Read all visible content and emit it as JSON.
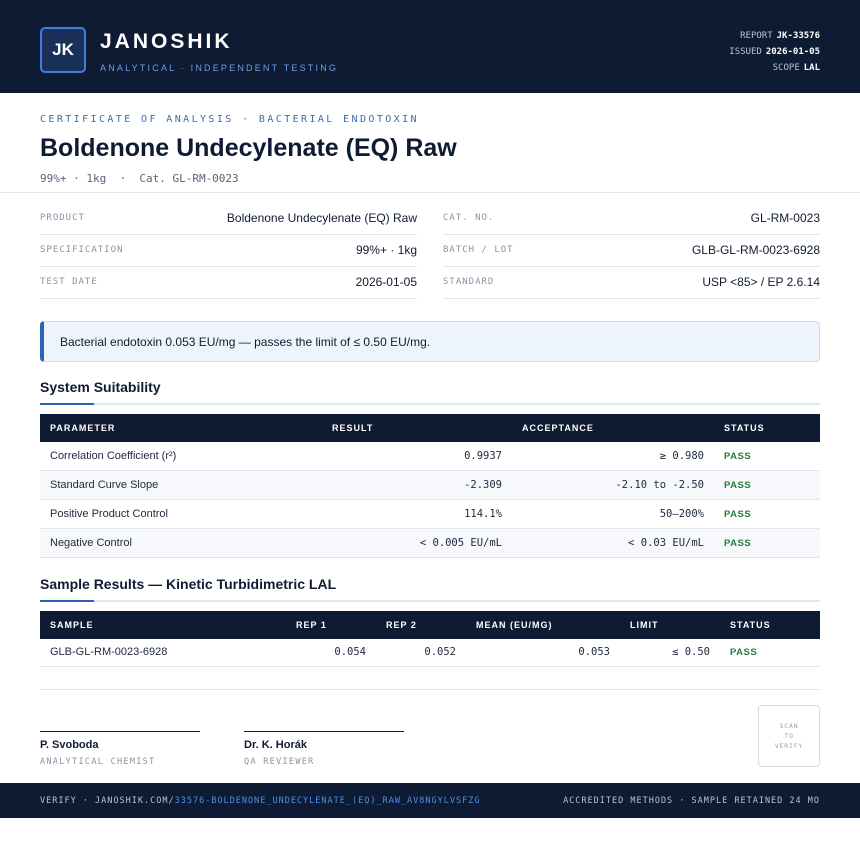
{
  "header": {
    "logo_text": "JK",
    "brand": "JANOSHIK",
    "brand_sub": "ANALYTICAL · INDEPENDENT TESTING",
    "report_label": "REPORT",
    "report_value": "JK-33576",
    "issued_label": "ISSUED",
    "issued_value": "2026-01-05",
    "scope_label": "SCOPE",
    "scope_value": "LAL"
  },
  "title_block": {
    "kicker": "CERTIFICATE OF ANALYSIS · BACTERIAL ENDOTOXIN",
    "title": "Boldenone Undecylenate (EQ) Raw",
    "subtitle": "99%+ · 1kg  ·  Cat. GL-RM-0023"
  },
  "info": {
    "left": [
      {
        "label": "PRODUCT",
        "value": "Boldenone Undecylenate (EQ) Raw"
      },
      {
        "label": "SPECIFICATION",
        "value": "99%+ · 1kg"
      },
      {
        "label": "TEST DATE",
        "value": "2026-01-05"
      }
    ],
    "right": [
      {
        "label": "CAT. NO.",
        "value": "GL-RM-0023"
      },
      {
        "label": "BATCH / LOT",
        "value": "GLB-GL-RM-0023-6928"
      },
      {
        "label": "STANDARD",
        "value": "USP <85> / EP 2.6.14"
      }
    ]
  },
  "summary": "Bacterial endotoxin 0.053 EU/mg — passes the limit of ≤ 0.50 EU/mg.",
  "suitability": {
    "title": "System Suitability",
    "headers": [
      "PARAMETER",
      "RESULT",
      "ACCEPTANCE",
      "STATUS"
    ],
    "rows": [
      {
        "parameter": "Correlation Coefficient (r²)",
        "result": "0.9937",
        "acceptance": "≥ 0.980",
        "status": "PASS"
      },
      {
        "parameter": "Standard Curve Slope",
        "result": "-2.309",
        "acceptance": "-2.10 to -2.50",
        "status": "PASS"
      },
      {
        "parameter": "Positive Product Control",
        "result": "114.1%",
        "acceptance": "50–200%",
        "status": "PASS"
      },
      {
        "parameter": "Negative Control",
        "result": "< 0.005 EU/mL",
        "acceptance": "< 0.03 EU/mL",
        "status": "PASS"
      }
    ]
  },
  "samples": {
    "title": "Sample Results — Kinetic Turbidimetric LAL",
    "headers": [
      "SAMPLE",
      "REP 1",
      "REP 2",
      "MEAN (EU/MG)",
      "LIMIT",
      "STATUS"
    ],
    "rows": [
      {
        "sample": "GLB-GL-RM-0023-6928",
        "rep1": "0.054",
        "rep2": "0.052",
        "mean": "0.053",
        "limit": "≤ 0.50",
        "status": "PASS"
      }
    ]
  },
  "signatures": [
    {
      "name": "P. Svoboda",
      "role": "ANALYTICAL CHEMIST"
    },
    {
      "name": "Dr. K. Horák",
      "role": "QA REVIEWER"
    }
  ],
  "qr_text": [
    "SCAN",
    "TO",
    "VERIFY"
  ],
  "footer": {
    "verify_prefix": "VERIFY · JANOSHIK.COM/",
    "verify_link": "33576-BOLDENONE_UNDECYLENATE_(EQ)_RAW_AV8NGYLVSFZG",
    "right": "ACCREDITED METHODS · SAMPLE RETAINED 24 MO"
  },
  "colors": {
    "navy": "#0f1b33",
    "accent": "#2a63b8",
    "pass": "#2a7a3a"
  }
}
